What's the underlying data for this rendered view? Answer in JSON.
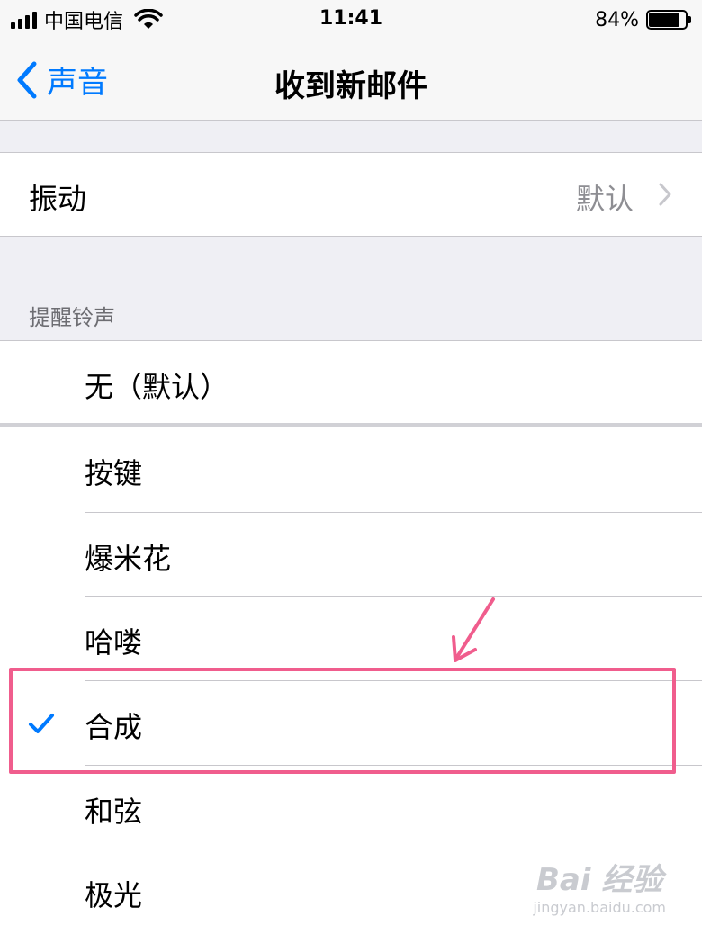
{
  "status_bar": {
    "carrier": "中国电信",
    "time": "11:41",
    "battery_percent": "84%",
    "battery_level": 0.84
  },
  "nav": {
    "back_label": "声音",
    "title": "收到新邮件"
  },
  "vibration": {
    "label": "振动",
    "value": "默认"
  },
  "alert_tones": {
    "header": "提醒铃声",
    "default_option": "无（默认）",
    "items": [
      {
        "label": "按键"
      },
      {
        "label": "爆米花"
      },
      {
        "label": "哈喽"
      },
      {
        "label": "合成",
        "selected": true
      },
      {
        "label": "和弦"
      },
      {
        "label": "极光"
      }
    ]
  },
  "colors": {
    "accent": "#007aff",
    "annotation": "#f05d8d",
    "group_background": "#efeff4"
  },
  "watermark": {
    "brand": "Bai 经验",
    "url": "jingyan.baidu.com"
  }
}
